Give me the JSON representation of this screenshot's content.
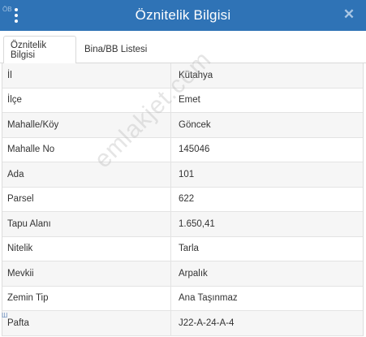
{
  "window": {
    "title": "Öznitelik Bilgisi",
    "corner_label": "ÖB",
    "menu_icon": "vertical-dots-icon",
    "close_icon": "close-icon",
    "close_glyph": "✕",
    "accent_color": "#2f73b6"
  },
  "tabs": [
    {
      "label": "Öznitelik Bilgisi",
      "active": true
    },
    {
      "label": "Bina/BB Listesi",
      "active": false
    }
  ],
  "attributes": [
    {
      "key": "İl",
      "value": "Kütahya"
    },
    {
      "key": "İlçe",
      "value": "Emet"
    },
    {
      "key": "Mahalle/Köy",
      "value": "Göncek"
    },
    {
      "key": "Mahalle No",
      "value": "145046"
    },
    {
      "key": "Ada",
      "value": "101"
    },
    {
      "key": "Parsel",
      "value": "622"
    },
    {
      "key": "Tapu Alanı",
      "value": "1.650,41"
    },
    {
      "key": "Nitelik",
      "value": "Tarla"
    },
    {
      "key": "Mevkii",
      "value": "Arpalık"
    },
    {
      "key": "Zemin Tip",
      "value": "Ana Taşınmaz"
    },
    {
      "key": "Pafta",
      "value": "J22-A-24-A-4"
    }
  ],
  "watermark": "emlakjet.com",
  "scroll_mark": "Ш"
}
